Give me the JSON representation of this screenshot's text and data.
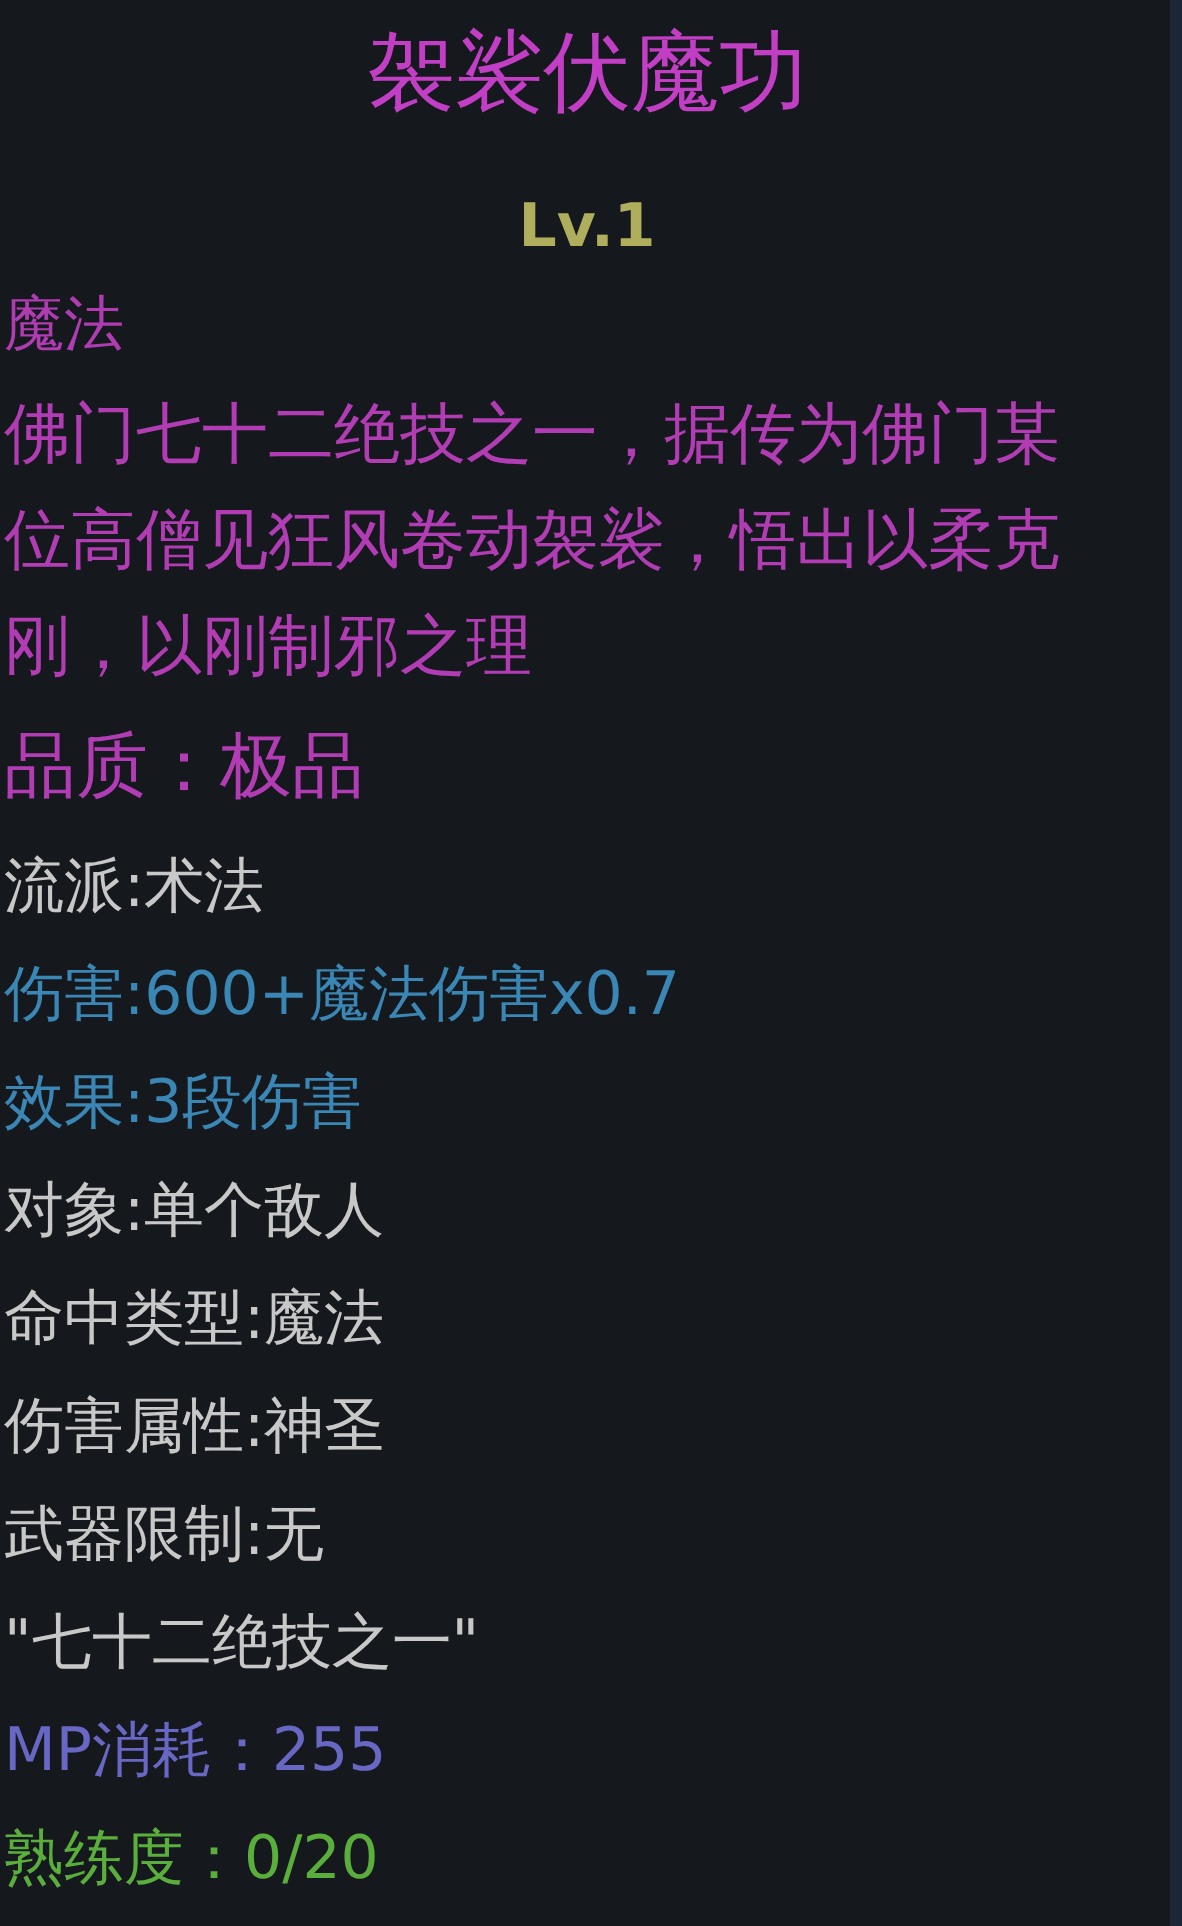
{
  "title": "袈裟伏魔功",
  "level_text": "Lv.1",
  "skill_type": "魔法",
  "description": "佛门七十二绝技之一，据传为佛门某位高僧见狂风卷动袈裟，悟出以柔克刚，以刚制邪之理",
  "quality": "品质：极品",
  "lines": [
    {
      "text": "流派:术法",
      "color": "#c8c8c8"
    },
    {
      "text": "伤害:600+魔法伤害x0.7",
      "color": "#3a86b4"
    },
    {
      "text": "效果:3段伤害",
      "color": "#3a86b4"
    },
    {
      "text": "对象:单个敌人",
      "color": "#c8c8c8"
    },
    {
      "text": "命中类型:魔法",
      "color": "#c8c8c8"
    },
    {
      "text": "伤害属性:神圣",
      "color": "#c8c8c8"
    },
    {
      "text": "武器限制:无",
      "color": "#c8c8c8"
    },
    {
      "text": "\"七十二绝技之一\"",
      "color": "#c8c8c8"
    },
    {
      "text": "MP消耗：255",
      "color": "#6868c4"
    },
    {
      "text": "熟练度：0/20",
      "color": "#5aae3c"
    }
  ]
}
